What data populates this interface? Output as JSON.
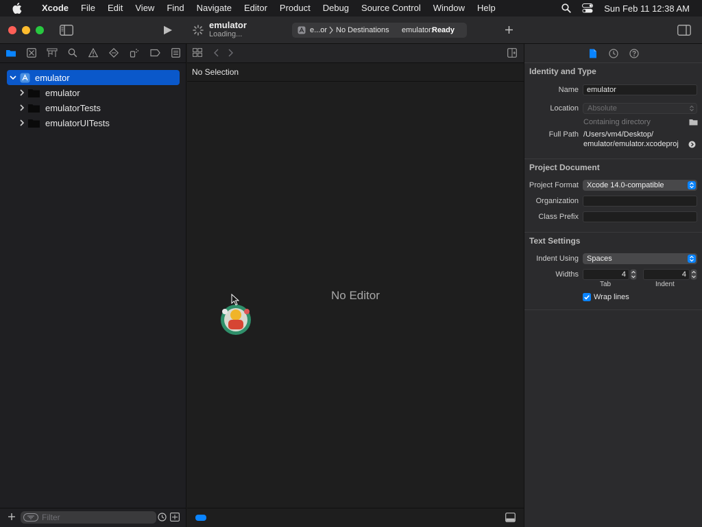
{
  "menubar": {
    "app": "Xcode",
    "items": [
      "File",
      "Edit",
      "View",
      "Find",
      "Navigate",
      "Editor",
      "Product",
      "Debug",
      "Source Control",
      "Window",
      "Help"
    ],
    "clock": "Sun Feb 11  12:38 AM"
  },
  "toolbar": {
    "project_title": "emulator",
    "status_subtitle": "Loading...",
    "scheme_short": "e...or",
    "destination": "No Destinations",
    "activity_prefix": "emulator:",
    "activity_state": "Ready"
  },
  "navigator": {
    "tree": [
      {
        "label": "emulator",
        "kind": "project",
        "expanded": true,
        "selected": true
      },
      {
        "label": "emulator",
        "kind": "folder"
      },
      {
        "label": "emulatorTests",
        "kind": "folder"
      },
      {
        "label": "emulatorUITests",
        "kind": "folder"
      }
    ],
    "filter_placeholder": "Filter"
  },
  "editor": {
    "jump_bar": "No Selection",
    "empty_text": "No Editor"
  },
  "inspector": {
    "identity": {
      "title": "Identity and Type",
      "name_label": "Name",
      "name_value": "emulator",
      "location_label": "Location",
      "location_value": "Absolute",
      "containing_hint": "Containing directory",
      "fullpath_label": "Full Path",
      "fullpath_line1": "/Users/vm4/Desktop/",
      "fullpath_line2": "emulator/emulator.xcodeproj"
    },
    "project_doc": {
      "title": "Project Document",
      "format_label": "Project Format",
      "format_value": "Xcode 14.0-compatible",
      "org_label": "Organization",
      "org_value": "",
      "prefix_label": "Class Prefix",
      "prefix_value": ""
    },
    "text_settings": {
      "title": "Text Settings",
      "indent_label": "Indent Using",
      "indent_value": "Spaces",
      "widths_label": "Widths",
      "tab_value": "4",
      "indent_width_value": "4",
      "tab_caption": "Tab",
      "indent_caption": "Indent",
      "wrap_label": "Wrap lines",
      "wrap_checked": true
    }
  },
  "colors": {
    "accent": "#0a84ff",
    "selection": "#0a58ca"
  }
}
